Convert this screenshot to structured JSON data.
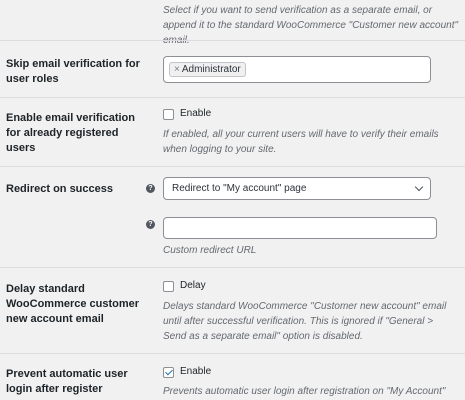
{
  "top_description": "Select if you want to send verification as a separate email, or append it to the standard WooCommerce \"Customer new account\" email.",
  "skip_roles": {
    "label": "Skip email verification for user roles",
    "tags": [
      {
        "remove": "×",
        "text": "Administrator"
      }
    ]
  },
  "enable_registered": {
    "label": "Enable email verification for already registered users",
    "checkbox_label": "Enable",
    "checked": false,
    "description": "If enabled, all your current users will have to verify their emails when logging to your site."
  },
  "redirect": {
    "label": "Redirect on success",
    "help_icon": "?",
    "selected": "Redirect to \"My account\" page",
    "custom_url_value": "",
    "custom_url_description": "Custom redirect URL"
  },
  "delay": {
    "label": "Delay standard WooCommerce customer new account email",
    "checkbox_label": "Delay",
    "checked": false,
    "description": "Delays standard WooCommerce \"Customer new account\" email until after successful verification. This is ignored if \"General > Send as a separate email\" option is disabled."
  },
  "prevent_login": {
    "label": "Prevent automatic user login after register",
    "checkbox_label": "Enable",
    "checked": true,
    "description": "Prevents automatic user login after registration on \"My Account\" page."
  },
  "colors": {
    "background": "#f1f1f1",
    "divider": "#dcdcde",
    "check_accent": "#2271b1",
    "description_text": "#646970"
  }
}
